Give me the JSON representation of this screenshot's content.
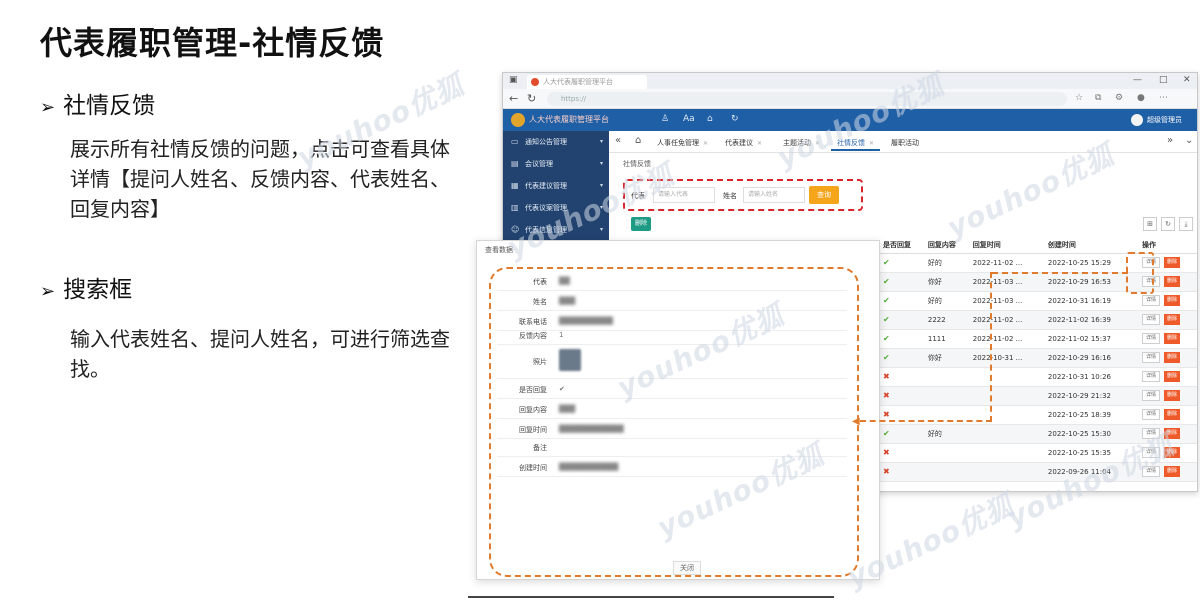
{
  "slide": {
    "title": "代表履职管理-社情反馈",
    "bullets": [
      {
        "heading": "社情反馈",
        "text": "展示所有社情反馈的问题，点击可查看具体详情【提问人姓名、反馈内容、代表姓名、回复内容】"
      },
      {
        "heading": "搜索框",
        "text": "输入代表姓名、提问人姓名，可进行筛选查找。"
      }
    ]
  },
  "browser": {
    "tab_title": "人大代表履职管理平台",
    "app_name": "人大代表履职管理平台",
    "user": "超级管理员"
  },
  "sidebar": {
    "items": [
      {
        "label": "通知公告管理"
      },
      {
        "label": "会议管理"
      },
      {
        "label": "代表建议管理"
      },
      {
        "label": "代表议案管理"
      },
      {
        "label": "代表信息管理"
      }
    ]
  },
  "page_tabs": [
    {
      "label": "人事任免管理",
      "active": false
    },
    {
      "label": "代表建议",
      "active": false
    },
    {
      "label": "主题活动",
      "active": false
    },
    {
      "label": "社情反馈",
      "active": true
    },
    {
      "label": "履职活动",
      "active": false
    }
  ],
  "content": {
    "breadcrumb": "社情反馈",
    "search": {
      "rep_label": "代表",
      "rep_placeholder": "请输入代表",
      "name_label": "姓名",
      "name_placeholder": "请输入姓名",
      "query_label": "查询"
    },
    "delete_label": "删除"
  },
  "table": {
    "headers": [
      "是否回复",
      "回复内容",
      "回复时间",
      "创建时间",
      "操作"
    ],
    "hidden_headers": [
      "代表",
      "姓名",
      "联系电话",
      "反馈内容"
    ],
    "rows": [
      {
        "replied": true,
        "content": "好的",
        "reply_time": "2022-11-02 ...",
        "created": "2022-10-25 15:29"
      },
      {
        "replied": true,
        "content": "你好",
        "reply_time": "2022-11-03 ...",
        "created": "2022-10-29 16:53"
      },
      {
        "replied": true,
        "content": "好的",
        "reply_time": "2022-11-03 ...",
        "created": "2022-10-31 16:19"
      },
      {
        "replied": true,
        "content": "2222",
        "reply_time": "2022-11-02 ...",
        "created": "2022-11-02 16:39"
      },
      {
        "replied": true,
        "content": "1111",
        "reply_time": "2022-11-02 ...",
        "created": "2022-11-02 15:37"
      },
      {
        "replied": true,
        "content": "你好",
        "reply_time": "2022-10-31 ...",
        "created": "2022-10-29 16:16"
      },
      {
        "replied": false,
        "content": "",
        "reply_time": "",
        "created": "2022-10-31 10:26"
      },
      {
        "replied": false,
        "content": "",
        "reply_time": "",
        "created": "2022-10-29 21:32"
      },
      {
        "replied": false,
        "content": "",
        "reply_time": "",
        "created": "2022-10-25 18:39"
      },
      {
        "replied": true,
        "content": "好的",
        "reply_time": "",
        "created": "2022-10-25 15:30"
      },
      {
        "replied": false,
        "content": "",
        "reply_time": "",
        "created": "2022-10-25 15:35"
      },
      {
        "replied": false,
        "content": "",
        "reply_time": "",
        "created": "2022-09-26 11:04"
      }
    ],
    "detail_label": "详情",
    "delete_label": "删除"
  },
  "detail": {
    "title": "查看数据",
    "fields": [
      {
        "label": "代表",
        "value": "██"
      },
      {
        "label": "姓名",
        "value": "███"
      },
      {
        "label": "联系电话",
        "value": "██████████"
      },
      {
        "label": "反馈内容",
        "value": "1"
      },
      {
        "label": "照片",
        "value": ""
      },
      {
        "label": "是否回复",
        "value": "✔"
      },
      {
        "label": "回复内容",
        "value": "███"
      },
      {
        "label": "回复时间",
        "value": "████████████"
      },
      {
        "label": "备注",
        "value": ""
      },
      {
        "label": "创建时间",
        "value": "███████████"
      }
    ],
    "close_label": "关闭"
  },
  "colors": {
    "header": "#1f5fa6",
    "sidebar": "#22436f",
    "query": "#f4a51a",
    "delete": "#ef5a2a",
    "annotation": "#e07a2c",
    "search_highlight": "#d9242b"
  },
  "watermark": "youhoo优狐"
}
